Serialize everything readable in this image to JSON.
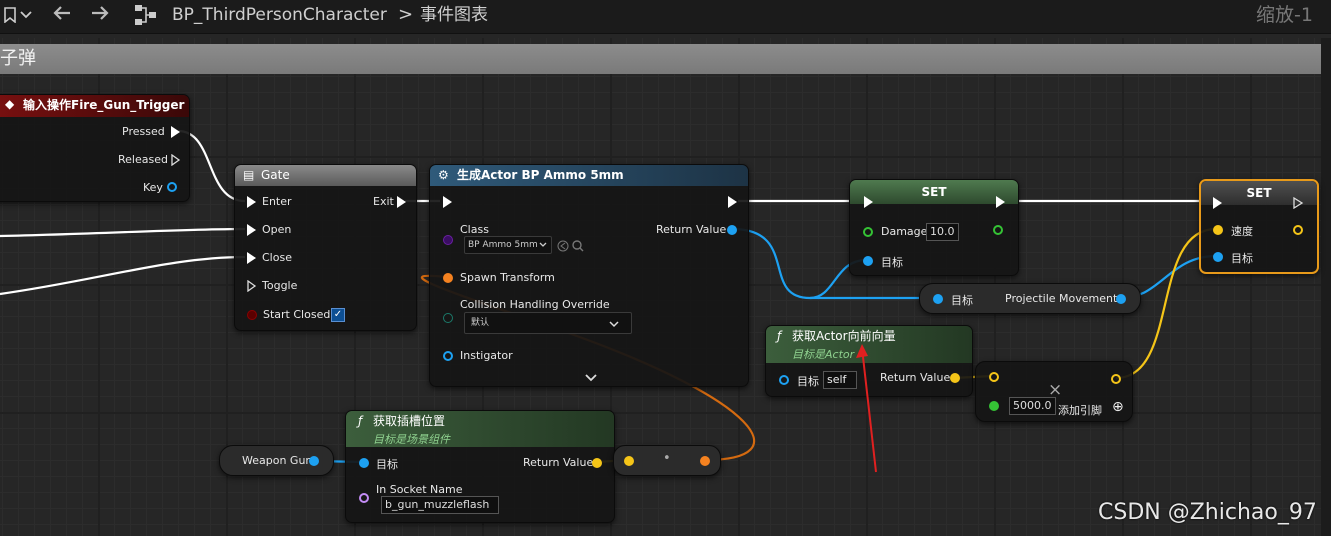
{
  "topbar": {
    "crumb": "BP_ThirdPersonCharacter",
    "separator": ">",
    "graph": "事件图表",
    "zoom": "缩放-1"
  },
  "comment": {
    "title": "射子弹"
  },
  "nodes": {
    "input": {
      "title": "输入操作Fire_Gun_Trigger",
      "pressed": "Pressed",
      "released": "Released",
      "key": "Key"
    },
    "gate": {
      "title": "Gate",
      "enter": "Enter",
      "exit": "Exit",
      "open": "Open",
      "close": "Close",
      "toggle": "Toggle",
      "start_closed": "Start Closed",
      "checkmark": "✓"
    },
    "spawn": {
      "title": "生成Actor BP Ammo 5mm",
      "class": "Class",
      "class_value": "BP Ammo 5mm",
      "return_value": "Return Value",
      "spawn_transform": "Spawn Transform",
      "collision": "Collision Handling Override",
      "collision_value": "默认",
      "instigator": "Instigator",
      "expand": "⌄"
    },
    "set_damage": {
      "title": "SET",
      "damage": "Damage",
      "damage_value": "10.0",
      "target": "目标"
    },
    "projectile": {
      "target": "目标",
      "label": "Projectile Movement"
    },
    "set_speed": {
      "title": "SET",
      "speed": "速度",
      "target": "目标"
    },
    "forward": {
      "title": "获取Actor向前向量",
      "subtitle": "目标是Actor",
      "target": "目标",
      "self": "self",
      "return_value": "Return Value"
    },
    "multiply": {
      "symbol": "×",
      "value": "5000.0",
      "add_pin": "添加引脚",
      "plus": "⊕"
    },
    "weapon": {
      "label": "Weapon Gun"
    },
    "socket": {
      "title": "获取插槽位置",
      "subtitle": "目标是场景组件",
      "target": "目标",
      "return_value": "Return Value",
      "in_socket": "In Socket Name",
      "socket_value": "b_gun_muzzleflash"
    },
    "break": {
      "dot": "•"
    }
  },
  "watermark": "CSDN @Zhichao_97",
  "colors": {
    "exec": "#ffffff",
    "object": "#1da1f2",
    "vector": "#f5c518",
    "transform": "#f58220",
    "float": "#35c335",
    "class": "#6a1fa3",
    "name": "#c38cf5",
    "bool": "#8b0000",
    "struct": "#1b7a6a",
    "annotation_arrow": "#e02020"
  }
}
